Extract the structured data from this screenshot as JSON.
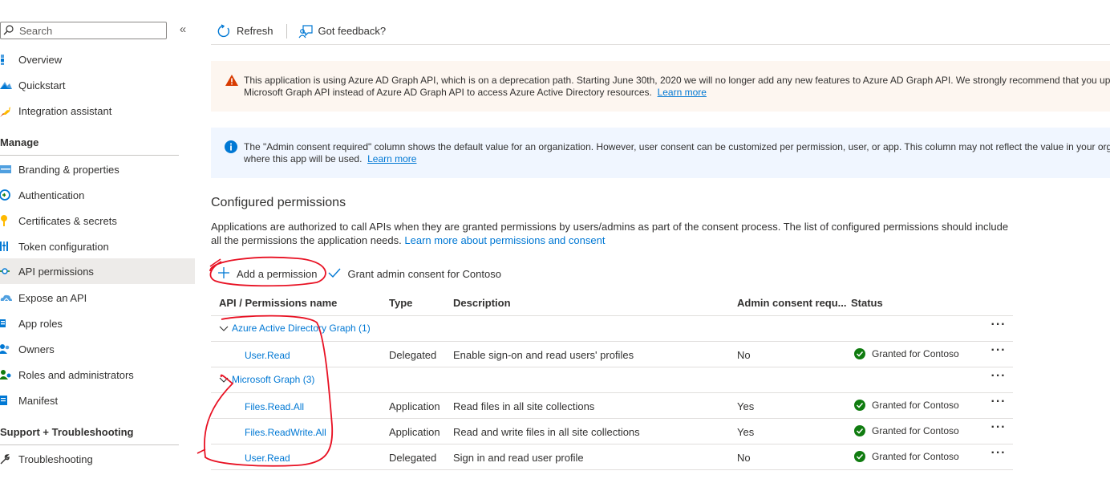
{
  "sidebar": {
    "search_placeholder": "Search",
    "collapse_glyph": "«",
    "items_top": [
      {
        "label": "Overview",
        "icon": "overview-icon"
      },
      {
        "label": "Quickstart",
        "icon": "quickstart-icon"
      },
      {
        "label": "Integration assistant",
        "icon": "rocket-icon"
      }
    ],
    "manage_heading": "Manage",
    "items_manage": [
      {
        "label": "Branding & properties",
        "icon": "branding-icon"
      },
      {
        "label": "Authentication",
        "icon": "authentication-icon"
      },
      {
        "label": "Certificates & secrets",
        "icon": "key-icon"
      },
      {
        "label": "Token configuration",
        "icon": "token-icon"
      },
      {
        "label": "API permissions",
        "icon": "api-permissions-icon",
        "active": true
      },
      {
        "label": "Expose an API",
        "icon": "cloud-icon"
      },
      {
        "label": "App roles",
        "icon": "app-roles-icon"
      },
      {
        "label": "Owners",
        "icon": "owners-icon"
      },
      {
        "label": "Roles and administrators",
        "icon": "roles-icon"
      },
      {
        "label": "Manifest",
        "icon": "manifest-icon"
      }
    ],
    "support_heading": "Support + Troubleshooting",
    "items_support": [
      {
        "label": "Troubleshooting",
        "icon": "wrench-icon"
      }
    ]
  },
  "toolbar": {
    "refresh_label": "Refresh",
    "feedback_label": "Got feedback?"
  },
  "warning_banner": {
    "line1": "This application is using Azure AD Graph API, which is on a deprecation path. Starting June 30th, 2020 we will no longer add any new features to Azure AD Graph API. We strongly recommend that you upg",
    "line2": "Microsoft Graph API instead of Azure AD Graph API to access Azure Active Directory resources.",
    "link": "Learn more"
  },
  "info_banner": {
    "line1": "The \"Admin consent required\" column shows the default value for an organization. However, user consent can be customized per permission, user, or app. This column may not reflect the value in your orga",
    "line2": "where this app will be used.",
    "link": "Learn more"
  },
  "permissions": {
    "title": "Configured permissions",
    "description": "Applications are authorized to call APIs when they are granted permissions by users/admins as part of the consent process. The list of configured permissions should include all the permissions the application needs.",
    "description_link": "Learn more about permissions and consent",
    "add_label": "Add a permission",
    "grant_label": "Grant admin consent for Contoso",
    "columns": {
      "name": "API / Permissions name",
      "type": "Type",
      "description": "Description",
      "admin": "Admin consent requ...",
      "status": "Status"
    },
    "groups": [
      {
        "name": "Azure Active Directory Graph (1)",
        "rows": [
          {
            "name": "User.Read",
            "type": "Delegated",
            "description": "Enable sign-on and read users' profiles",
            "admin": "No",
            "status": "Granted for Contoso"
          }
        ]
      },
      {
        "name": "Microsoft Graph (3)",
        "rows": [
          {
            "name": "Files.Read.All",
            "type": "Application",
            "description": "Read files in all site collections",
            "admin": "Yes",
            "status": "Granted for Contoso"
          },
          {
            "name": "Files.ReadWrite.All",
            "type": "Application",
            "description": "Read and write files in all site collections",
            "admin": "Yes",
            "status": "Granted for Contoso"
          },
          {
            "name": "User.Read",
            "type": "Delegated",
            "description": "Sign in and read user profile",
            "admin": "No",
            "status": "Granted for Contoso"
          }
        ]
      }
    ],
    "more_glyph": "···"
  },
  "colors": {
    "accent": "#0078d4",
    "success": "#107c10",
    "warning": "#d83b01",
    "annotation": "#e81123"
  }
}
